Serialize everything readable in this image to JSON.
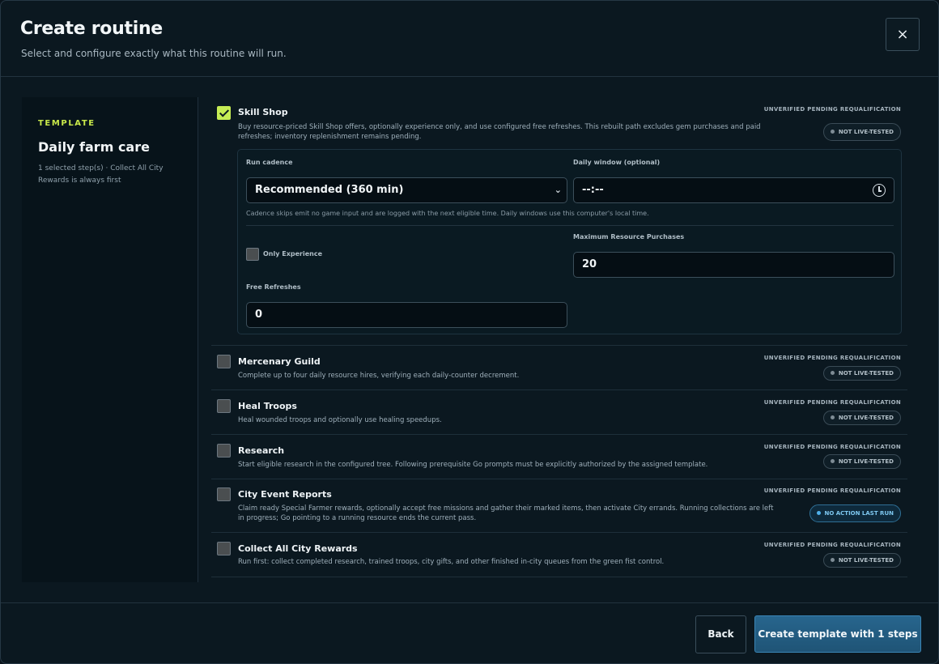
{
  "header": {
    "title": "Create routine",
    "subtitle": "Select and configure exactly what this routine will run.",
    "close_label": "×"
  },
  "sidebar": {
    "label": "TEMPLATE",
    "name": "Daily farm care",
    "description": "1 selected step(s) · Collect All City Rewards is always first"
  },
  "steps": [
    {
      "title": "Skill Shop",
      "checked": true,
      "description": "Buy resource-priced Skill Shop offers, optionally experience only, and use configured free refreshes. This rebuilt path excludes gem purchases and paid refreshes; inventory replenishment remains pending.",
      "requalification": "UNVERIFIED PENDING REQUALIFICATION",
      "badge": "NOT LIVE-TESTED"
    },
    {
      "title": "Mercenary Guild",
      "checked": false,
      "description": "Complete up to four daily resource hires, verifying each daily-counter decrement.",
      "requalification": "UNVERIFIED PENDING REQUALIFICATION",
      "badge": "NOT LIVE-TESTED"
    },
    {
      "title": "Heal Troops",
      "checked": false,
      "description": "Heal wounded troops and optionally use healing speedups.",
      "requalification": "UNVERIFIED PENDING REQUALIFICATION",
      "badge": "NOT LIVE-TESTED"
    },
    {
      "title": "Research",
      "checked": false,
      "description": "Start eligible research in the configured tree. Following prerequisite Go prompts must be explicitly authorized by the assigned template.",
      "requalification": "UNVERIFIED PENDING REQUALIFICATION",
      "badge": "NOT LIVE-TESTED"
    },
    {
      "title": "City Event Reports",
      "checked": false,
      "description": "Claim ready Special Farmer rewards, optionally accept free missions and gather their marked items, then activate City errands. Running collections are left in progress; Go pointing to a running resource ends the current pass.",
      "requalification": "UNVERIFIED PENDING REQUALIFICATION",
      "badge": "NO ACTION LAST RUN"
    },
    {
      "title": "Collect All City Rewards",
      "checked": false,
      "description": "Run first: collect completed research, trained troops, city gifts, and other finished in-city queues from the green fist control.",
      "requalification": "UNVERIFIED PENDING REQUALIFICATION",
      "badge": "NOT LIVE-TESTED"
    }
  ],
  "config": {
    "run_cadence_label": "Run cadence",
    "run_cadence_value": "Recommended (360 min)",
    "daily_window_label": "Daily window (optional)",
    "daily_window_value": "--:--",
    "note": "Cadence skips emit no game input and are logged with the next eligible time. Daily windows use this computer's local time.",
    "only_experience_label": "Only Experience",
    "only_experience_checked": false,
    "max_purchases_label": "Maximum Resource Purchases",
    "max_purchases_value": "20",
    "free_refreshes_label": "Free Refreshes",
    "free_refreshes_value": "0"
  },
  "footer": {
    "back_label": "Back",
    "create_label": "Create template with 1 steps"
  },
  "colors": {
    "accent_lime": "#c6ec54",
    "primary_button": "#27658d",
    "blue_badge": "#4fb0ea"
  }
}
